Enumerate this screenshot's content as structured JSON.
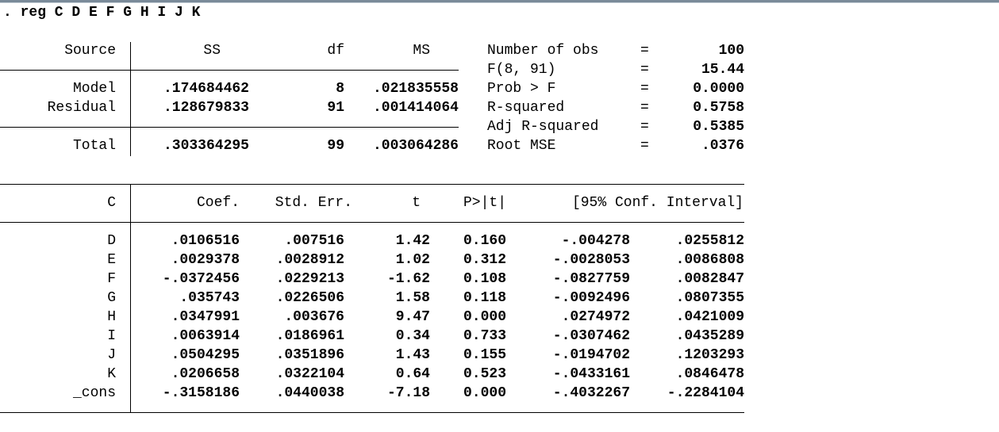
{
  "command": ". reg C D E F G H I J K",
  "anova": {
    "headers": [
      "Source",
      "SS",
      "df",
      "MS"
    ],
    "rows": [
      {
        "source": "Model",
        "ss": ".174684462",
        "df": "8",
        "ms": ".021835558"
      },
      {
        "source": "Residual",
        "ss": ".128679833",
        "df": "91",
        "ms": ".001414064"
      },
      {
        "source": "Total",
        "ss": ".303364295",
        "df": "99",
        "ms": ".003064286"
      }
    ]
  },
  "stats": [
    {
      "label": "Number of obs",
      "eq": "=",
      "value": "100"
    },
    {
      "label": "F(8, 91)",
      "eq": "=",
      "value": "15.44"
    },
    {
      "label": "Prob > F",
      "eq": "=",
      "value": "0.0000"
    },
    {
      "label": "R-squared",
      "eq": "=",
      "value": "0.5758"
    },
    {
      "label": "Adj R-squared",
      "eq": "=",
      "value": "0.5385"
    },
    {
      "label": "Root MSE",
      "eq": "=",
      "value": ".0376"
    }
  ],
  "coef": {
    "depvar": "C",
    "headers": [
      "Coef.",
      "Std. Err.",
      "t",
      "P>|t|",
      "[95% Conf. Interval]"
    ],
    "rows": [
      {
        "var": "D",
        "coef": ".0106516",
        "se": ".007516",
        "t": "1.42",
        "p": "0.160",
        "lo": "-.004278",
        "hi": ".0255812"
      },
      {
        "var": "E",
        "coef": ".0029378",
        "se": ".0028912",
        "t": "1.02",
        "p": "0.312",
        "lo": "-.0028053",
        "hi": ".0086808"
      },
      {
        "var": "F",
        "coef": "-.0372456",
        "se": ".0229213",
        "t": "-1.62",
        "p": "0.108",
        "lo": "-.0827759",
        "hi": ".0082847"
      },
      {
        "var": "G",
        "coef": ".035743",
        "se": ".0226506",
        "t": "1.58",
        "p": "0.118",
        "lo": "-.0092496",
        "hi": ".0807355"
      },
      {
        "var": "H",
        "coef": ".0347991",
        "se": ".003676",
        "t": "9.47",
        "p": "0.000",
        "lo": ".0274972",
        "hi": ".0421009"
      },
      {
        "var": "I",
        "coef": ".0063914",
        "se": ".0186961",
        "t": "0.34",
        "p": "0.733",
        "lo": "-.0307462",
        "hi": ".0435289"
      },
      {
        "var": "J",
        "coef": ".0504295",
        "se": ".0351896",
        "t": "1.43",
        "p": "0.155",
        "lo": "-.0194702",
        "hi": ".1203293"
      },
      {
        "var": "K",
        "coef": ".0206658",
        "se": ".0322104",
        "t": "0.64",
        "p": "0.523",
        "lo": "-.0433161",
        "hi": ".0846478"
      },
      {
        "var": "_cons",
        "coef": "-.3158186",
        "se": ".0440038",
        "t": "-7.18",
        "p": "0.000",
        "lo": "-.4032267",
        "hi": "-.2284104"
      }
    ]
  }
}
